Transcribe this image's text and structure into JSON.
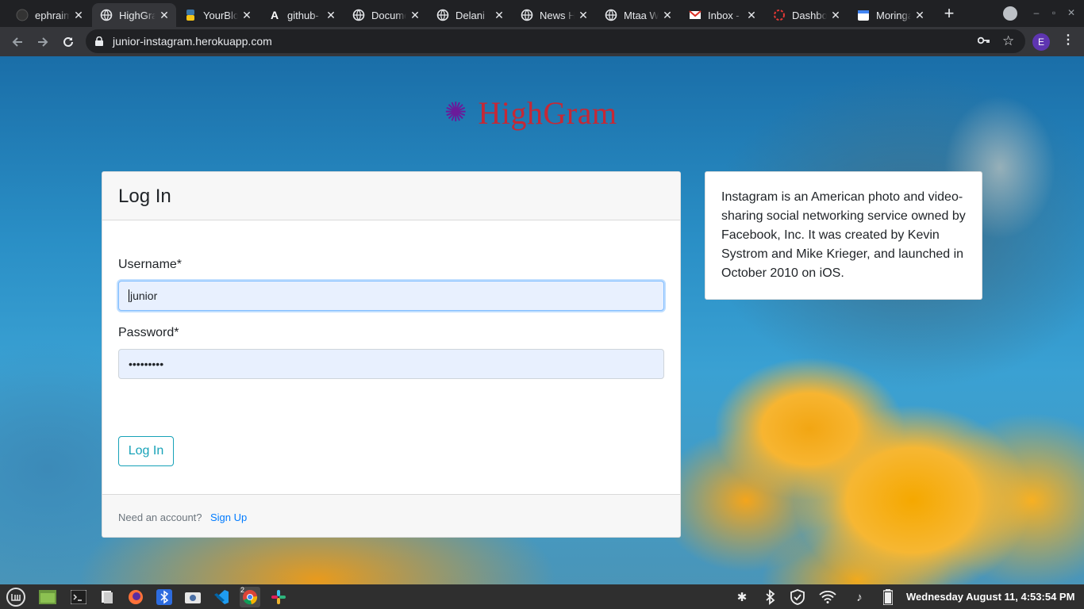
{
  "browser": {
    "tabs": [
      {
        "title": "ephraim",
        "icon": "github-icon",
        "active": false
      },
      {
        "title": "HighGram",
        "icon": "globe-icon",
        "active": true
      },
      {
        "title": "YourBlog",
        "icon": "python-icon",
        "active": false
      },
      {
        "title": "github-",
        "icon": "a-letter-icon",
        "active": false
      },
      {
        "title": "Documentation",
        "icon": "globe-icon",
        "active": false
      },
      {
        "title": "Delani",
        "icon": "globe-icon",
        "active": false
      },
      {
        "title": "News Highlights",
        "icon": "globe-icon",
        "active": false
      },
      {
        "title": "Mtaa Watch",
        "icon": "globe-icon",
        "active": false
      },
      {
        "title": "Inbox - ",
        "icon": "gmail-icon",
        "active": false
      },
      {
        "title": "Dashboard",
        "icon": "dashboard-icon",
        "active": false
      },
      {
        "title": "Moringa",
        "icon": "calendar-icon",
        "active": false
      }
    ],
    "close_glyph": "✕",
    "new_tab_glyph": "+",
    "url": "junior-instagram.herokuapp.com",
    "profile_initial": "E",
    "menu_glyph": "⋮",
    "star_glyph": "☆"
  },
  "page": {
    "logo_text": "HighGram",
    "logo_glyph": "✺",
    "login_card": {
      "title": "Log In",
      "username_label": "Username*",
      "username_value": "junior",
      "password_label": "Password*",
      "password_value": "•••••••••",
      "submit_label": "Log In",
      "footer_text": "Need an account?",
      "signup_link": "Sign Up"
    },
    "info_text": "Instagram is an American photo and video-sharing social networking service owned by Facebook, Inc. It was created by Kevin Systrom and Mike Krieger, and launched in October 2010 on iOS."
  },
  "taskbar": {
    "apps": [
      "mint-menu-icon",
      "file-manager-icon",
      "terminal-icon",
      "files-icon",
      "firefox-icon",
      "bluetooth-app-icon",
      "screenshot-icon",
      "vscode-icon",
      "chrome-icon",
      "slack-icon"
    ],
    "chrome_badge": "2",
    "clock": "Wednesday August 11, 4:53:54 PM"
  },
  "colors": {
    "accent": "#17a2b8",
    "link": "#007bff",
    "logo": "#c62835",
    "logo_star": "#6a1b9a"
  }
}
